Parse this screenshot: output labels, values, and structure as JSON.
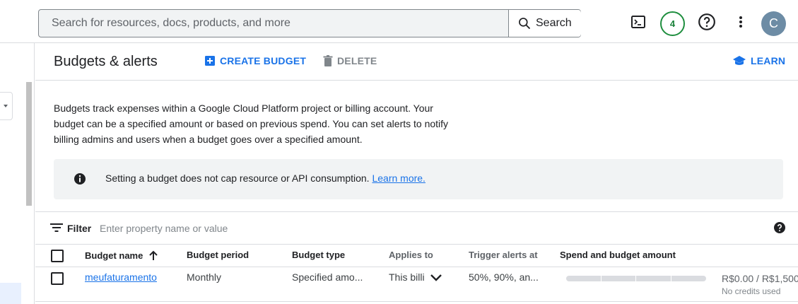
{
  "search": {
    "placeholder": "Search for resources, docs, products, and more",
    "button_label": "Search"
  },
  "topbar": {
    "notification_count": "4",
    "avatar_initial": "C"
  },
  "header": {
    "title": "Budgets & alerts",
    "create_label": "CREATE BUDGET",
    "delete_label": "DELETE",
    "learn_label": "LEARN"
  },
  "description": "Budgets track expenses within a Google Cloud Platform project or billing account. Your budget can be a specified amount or based on previous spend. You can set alerts to notify billing admins and users when a budget goes over a specified amount.",
  "info": {
    "text": "Setting a budget does not cap resource or API consumption.",
    "link": "Learn more."
  },
  "filter": {
    "label": "Filter",
    "placeholder": "Enter property name or value"
  },
  "table": {
    "columns": {
      "name": "Budget name",
      "period": "Budget period",
      "type": "Budget type",
      "applies": "Applies to",
      "trigger": "Trigger alerts at",
      "spend": "Spend and budget amount"
    },
    "rows": [
      {
        "name": "meufaturamento",
        "period": "Monthly",
        "type": "Specified amo...",
        "applies": "This billi",
        "trigger": "50%, 90%, an...",
        "spend_progress": 0,
        "amount": "R$0.00 / R$1,500",
        "credits": "No credits used"
      }
    ]
  },
  "colors": {
    "accent": "#1a73e8",
    "badge": "#188038",
    "avatar": "#6d8ca5"
  }
}
